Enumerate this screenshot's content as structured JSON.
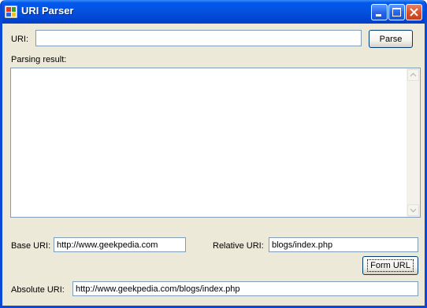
{
  "window": {
    "title": "URI Parser",
    "minimize_label": "Minimize",
    "maximize_label": "Maximize",
    "close_label": "Close"
  },
  "uri": {
    "label": "URI:",
    "value": ""
  },
  "parse_button": "Parse",
  "result": {
    "label": "Parsing result:",
    "value": ""
  },
  "base_uri": {
    "label": "Base URI:",
    "value": "http://www.geekpedia.com"
  },
  "relative_uri": {
    "label": "Relative URI:",
    "value": "blogs/index.php"
  },
  "form_url_button": "Form URL",
  "absolute_uri": {
    "label": "Absolute URI:",
    "value": "http://www.geekpedia.com/blogs/index.php"
  }
}
